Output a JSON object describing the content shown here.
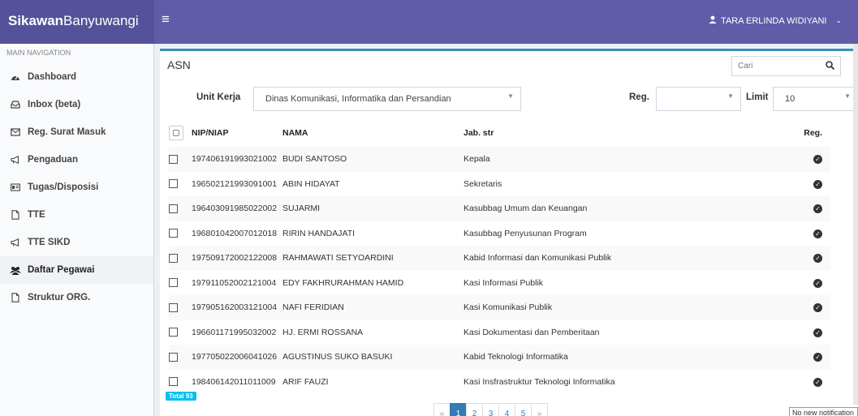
{
  "brand": {
    "bold": "Sikawan",
    "rest": "Banyuwangi"
  },
  "header": {
    "user_name": "TARA ERLINDA WIDIYANI"
  },
  "sidebar": {
    "header": "MAIN NAVIGATION",
    "items": [
      {
        "label": "Dashboard",
        "icon": "dashboard-icon"
      },
      {
        "label": "Inbox (beta)",
        "icon": "inbox-icon"
      },
      {
        "label": "Reg. Surat Masuk",
        "icon": "envelope-icon"
      },
      {
        "label": "Pengaduan",
        "icon": "bullhorn-icon"
      },
      {
        "label": "Tugas/Disposisi",
        "icon": "id-card-icon"
      },
      {
        "label": "TTE",
        "icon": "file-icon"
      },
      {
        "label": "TTE SIKD",
        "icon": "bullhorn-icon"
      },
      {
        "label": "Daftar Pegawai",
        "icon": "users-icon",
        "active": true
      },
      {
        "label": "Struktur ORG.",
        "icon": "file-icon"
      }
    ]
  },
  "main": {
    "title": "ASN",
    "search_placeholder": "Cari",
    "filters": {
      "unit_label": "Unit Kerja",
      "unit_value": "Dinas Komunikasi, Informatika dan Persandian",
      "reg_label": "Reg.",
      "reg_value": "",
      "limit_label": "Limit",
      "limit_value": "10"
    },
    "table": {
      "columns": [
        "NIP/NIAP",
        "NAMA",
        "Jab. str",
        "Reg."
      ],
      "rows": [
        {
          "nip": "197406191993021002",
          "nama": "BUDI SANTOSO",
          "jab": "Kepala"
        },
        {
          "nip": "196502121993091001",
          "nama": "ABIN HIDAYAT",
          "jab": "Sekretaris"
        },
        {
          "nip": "196403091985022002",
          "nama": "SUJARMI",
          "jab": "Kasubbag Umum dan Keuangan"
        },
        {
          "nip": "196801042007012018",
          "nama": "RIRIN HANDAJATI",
          "jab": "Kasubbag Penyusunan Program"
        },
        {
          "nip": "197509172002122008",
          "nama": "RAHMAWATI SETYOARDINI",
          "jab": "Kabid Informasi dan Komunikasi Publik"
        },
        {
          "nip": "197911052002121004",
          "nama": "EDY FAKHRURAHMAN HAMID",
          "jab": "Kasi Informasi Publik"
        },
        {
          "nip": "197905162003121004",
          "nama": "NAFI FERIDIAN",
          "jab": "Kasi Komunikasi Publik"
        },
        {
          "nip": "196601171995032002",
          "nama": "HJ. ERMI ROSSANA",
          "jab": "Kasi Dokumentasi dan Pemberitaan"
        },
        {
          "nip": "197705022006041026",
          "nama": "AGUSTINUS SUKO BASUKI",
          "jab": "Kabid Teknologi Informatika"
        },
        {
          "nip": "198406142011011009",
          "nama": "ARIF FAUZI",
          "jab": "Kasi Insfrastruktur Teknologi Informatika"
        }
      ]
    },
    "total": "Total 93",
    "pagination": [
      "«",
      "1",
      "2",
      "3",
      "4",
      "5",
      "»"
    ]
  },
  "notification": "No new notification"
}
